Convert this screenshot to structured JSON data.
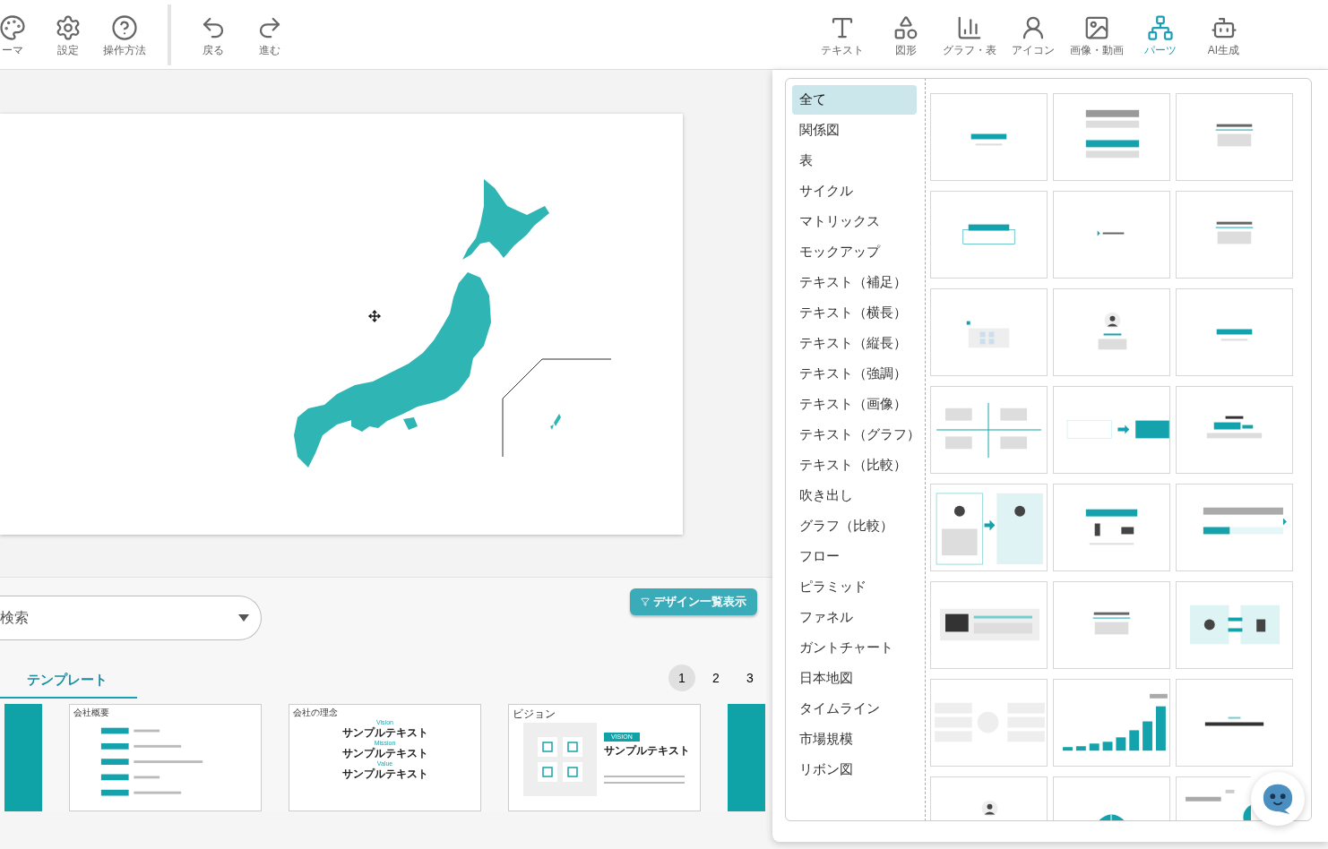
{
  "toolbar": {
    "left_items": [
      {
        "label": "ーマ"
      },
      {
        "label": "設定"
      },
      {
        "label": "操作方法"
      }
    ],
    "history_items": [
      {
        "label": "戻る"
      },
      {
        "label": "進む"
      }
    ],
    "insert_items": [
      {
        "label": "テキスト",
        "selected": false
      },
      {
        "label": "図形",
        "selected": false
      },
      {
        "label": "グラフ・表",
        "selected": false
      },
      {
        "label": "アイコン",
        "selected": false
      },
      {
        "label": "画像・動画",
        "selected": false
      },
      {
        "label": "パーツ",
        "selected": true
      },
      {
        "label": "AI生成",
        "selected": false
      }
    ]
  },
  "search": {
    "placeholder": "検索"
  },
  "design_list_button": "デザイン一覧表示",
  "tabs": [
    {
      "label": "テンプレート",
      "selected": true
    }
  ],
  "pages": [
    {
      "label": "1",
      "selected": true
    },
    {
      "label": "2",
      "selected": false
    },
    {
      "label": "3",
      "selected": false
    }
  ],
  "templates": [
    {
      "kind": "cover"
    },
    {
      "kind": "overview",
      "title": "会社概要"
    },
    {
      "kind": "philosophy",
      "title": "会社の理念",
      "items": [
        {
          "label": "Vision",
          "text": "サンプルテキスト"
        },
        {
          "label": "Mission",
          "text": "サンプルテキスト"
        },
        {
          "label": "Value",
          "text": "サンプルテキスト"
        }
      ]
    },
    {
      "kind": "vision",
      "title": "ビジョン",
      "badge": "VISION",
      "text": "サンプルテキスト"
    },
    {
      "kind": "cover"
    }
  ],
  "parts_panel": {
    "categories": [
      {
        "label": "全て",
        "selected": true
      },
      {
        "label": "関係図",
        "selected": false
      },
      {
        "label": "表",
        "selected": false
      },
      {
        "label": "サイクル",
        "selected": false
      },
      {
        "label": "マトリックス",
        "selected": false
      },
      {
        "label": "モックアップ",
        "selected": false
      },
      {
        "label": "テキスト（補足）",
        "selected": false
      },
      {
        "label": "テキスト（横長）",
        "selected": false
      },
      {
        "label": "テキスト（縦長）",
        "selected": false
      },
      {
        "label": "テキスト（強調）",
        "selected": false
      },
      {
        "label": "テキスト（画像）",
        "selected": false
      },
      {
        "label": "テキスト（グラフ）",
        "selected": false
      },
      {
        "label": "テキスト（比較）",
        "selected": false
      },
      {
        "label": "吹き出し",
        "selected": false
      },
      {
        "label": "グラフ（比較）",
        "selected": false
      },
      {
        "label": "フロー",
        "selected": false
      },
      {
        "label": "ピラミッド",
        "selected": false
      },
      {
        "label": "ファネル",
        "selected": false
      },
      {
        "label": "ガントチャート",
        "selected": false
      },
      {
        "label": "日本地図",
        "selected": false
      },
      {
        "label": "タイムライン",
        "selected": false
      },
      {
        "label": "市場規模",
        "selected": false
      },
      {
        "label": "リボン図",
        "selected": false
      }
    ],
    "parts": [
      {
        "kind": "banner"
      },
      {
        "kind": "blocks"
      },
      {
        "kind": "heading"
      },
      {
        "kind": "boxed"
      },
      {
        "kind": "arrow"
      },
      {
        "kind": "heading"
      },
      {
        "kind": "icons"
      },
      {
        "kind": "person"
      },
      {
        "kind": "banner"
      },
      {
        "kind": "matrix"
      },
      {
        "kind": "flow"
      },
      {
        "kind": "number"
      },
      {
        "kind": "compare"
      },
      {
        "kind": "people"
      },
      {
        "kind": "bars"
      },
      {
        "kind": "image"
      },
      {
        "kind": "heading"
      },
      {
        "kind": "exchange"
      },
      {
        "kind": "mindmap"
      },
      {
        "kind": "chart"
      },
      {
        "kind": "title"
      },
      {
        "kind": "person"
      },
      {
        "kind": "pie"
      },
      {
        "kind": "steps"
      }
    ]
  }
}
